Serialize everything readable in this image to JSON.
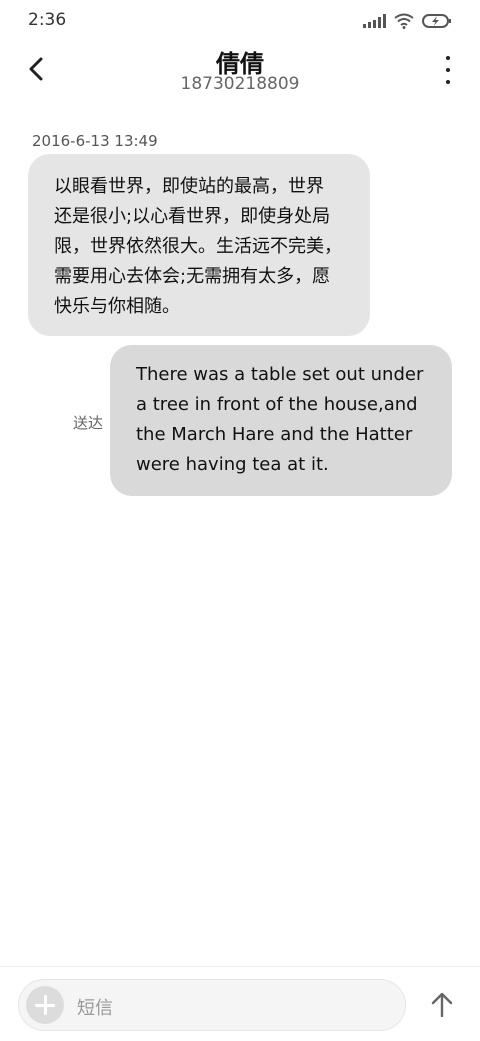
{
  "status_bar": {
    "time": "2:36"
  },
  "header": {
    "contact_name": "倩倩",
    "contact_number": "18730218809"
  },
  "messages": [
    {
      "direction": "incoming",
      "timestamp": "2016-6-13 13:49",
      "lines": [
        "以眼看世界，即使站的最高，世界",
        "还是很小;以心看世界，即使身处局",
        "限，世界依然很大。生活远不完美，",
        "需要用心去体会;无需拥有太多，愿",
        "快乐与你相随。"
      ]
    },
    {
      "direction": "outgoing",
      "status": "送达",
      "lines": [
        "There was a table set out under",
        "a tree in front of the house,and",
        "the March Hare and the Hatter",
        "were having tea at it."
      ]
    }
  ],
  "composer": {
    "placeholder": "短信"
  },
  "icons": {
    "back": "chevron-left-icon",
    "more": "more-vertical-icon",
    "add": "plus-icon",
    "send": "arrow-up-icon",
    "signal": "signal-icon",
    "wifi": "wifi-icon",
    "battery": "battery-charging-icon"
  }
}
